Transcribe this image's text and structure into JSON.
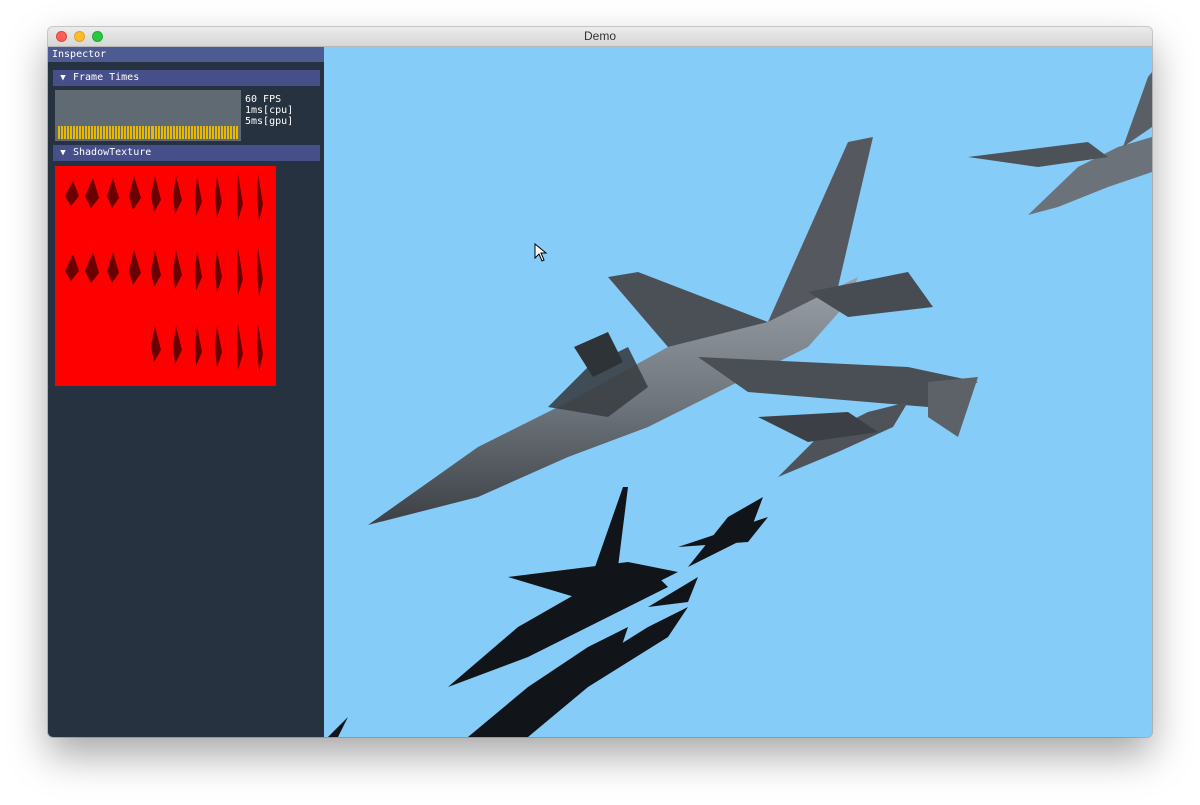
{
  "window": {
    "title": "Demo"
  },
  "inspector": {
    "title": "Inspector",
    "frame_times": {
      "header": "Frame Times",
      "fps": "60 FPS",
      "cpu": "1ms[cpu]",
      "gpu": "5ms[gpu]"
    },
    "shadow_texture": {
      "header": "ShadowTexture"
    }
  },
  "colors": {
    "sky": "#85ccf8",
    "panel": "#26323f",
    "header": "#474f8a",
    "bar": "#e6b800",
    "shadow_texture": "#ff0000"
  }
}
